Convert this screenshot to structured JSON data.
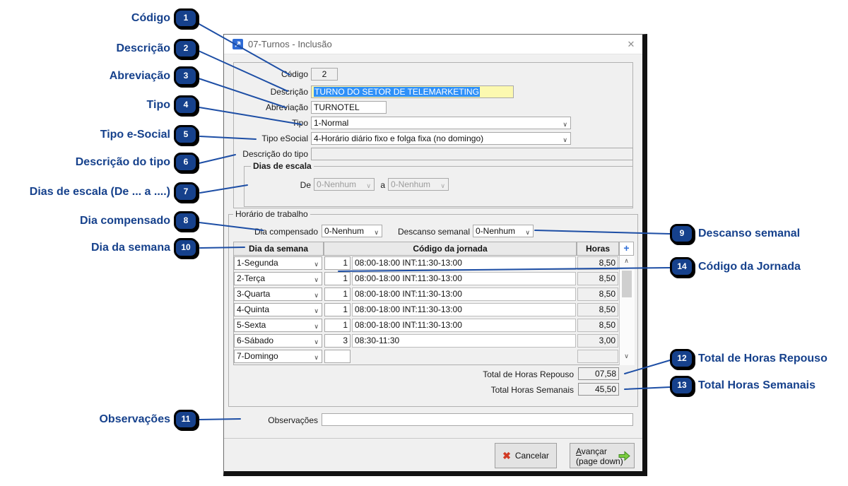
{
  "dialog": {
    "title": "07-Turnos - Inclusão",
    "fields": {
      "codigo": {
        "label": "Código",
        "value": "2"
      },
      "descricao": {
        "label": "Descrição",
        "value": "TURNO DO SETOR DE TELEMARKETING"
      },
      "abreviacao": {
        "label": "Abreviação",
        "value": "TURNOTEL"
      },
      "tipo": {
        "label": "Tipo",
        "value": "1-Normal"
      },
      "tipo_esocial": {
        "label": "Tipo eSocial",
        "value": "4-Horário diário fixo e folga fixa (no domingo)"
      },
      "descricao_tipo": {
        "label": "Descrição do tipo",
        "value": ""
      }
    },
    "dias_escala": {
      "legend": "Dias de escala",
      "de_label": "De",
      "de_value": "0-Nenhum",
      "a_label": "a",
      "a_value": "0-Nenhum"
    },
    "horario": {
      "legend": "Horário de trabalho",
      "dia_compensado": {
        "label": "Dia compensado",
        "value": "0-Nenhum"
      },
      "descanso_semanal": {
        "label": "Descanso semanal",
        "value": "0-Nenhum"
      },
      "table": {
        "headers": [
          "Dia da semana",
          "Código da jornada",
          "Horas"
        ],
        "rows": [
          {
            "dia": "1-Segunda",
            "codigo": "1",
            "jornada": "08:00-18:00 INT:11:30-13:00",
            "horas": "8,50"
          },
          {
            "dia": "2-Terça",
            "codigo": "1",
            "jornada": "08:00-18:00 INT:11:30-13:00",
            "horas": "8,50"
          },
          {
            "dia": "3-Quarta",
            "codigo": "1",
            "jornada": "08:00-18:00 INT:11:30-13:00",
            "horas": "8,50"
          },
          {
            "dia": "4-Quinta",
            "codigo": "1",
            "jornada": "08:00-18:00 INT:11:30-13:00",
            "horas": "8,50"
          },
          {
            "dia": "5-Sexta",
            "codigo": "1",
            "jornada": "08:00-18:00 INT:11:30-13:00",
            "horas": "8,50"
          },
          {
            "dia": "6-Sábado",
            "codigo": "3",
            "jornada": "08:30-11:30",
            "horas": "3,00"
          },
          {
            "dia": "7-Domingo",
            "codigo": "",
            "jornada": "",
            "horas": ""
          }
        ]
      },
      "totals": [
        {
          "label": "Total de Horas Repouso",
          "value": "07,58"
        },
        {
          "label": "Total Horas Semanais",
          "value": "45,50"
        }
      ]
    },
    "observacoes": {
      "label": "Observações",
      "value": ""
    },
    "buttons": {
      "cancel": "Cancelar",
      "next_line1": "Avançar",
      "next_line2": "(page down)"
    }
  },
  "annotations": {
    "left": [
      {
        "num": "1",
        "label": "Código"
      },
      {
        "num": "2",
        "label": "Descrição"
      },
      {
        "num": "3",
        "label": "Abreviação"
      },
      {
        "num": "4",
        "label": "Tipo"
      },
      {
        "num": "5",
        "label": "Tipo e-Social"
      },
      {
        "num": "6",
        "label": "Descrição do tipo"
      },
      {
        "num": "7",
        "label": "Dias de escala (De ... a ....)"
      },
      {
        "num": "8",
        "label": "Dia compensado"
      },
      {
        "num": "10",
        "label": "Dia da semana"
      },
      {
        "num": "11",
        "label": "Observações"
      }
    ],
    "right": [
      {
        "num": "9",
        "label": "Descanso semanal"
      },
      {
        "num": "14",
        "label": "Código da Jornada"
      },
      {
        "num": "12",
        "label": "Total de Horas Repouso"
      },
      {
        "num": "13",
        "label": "Total Horas Semanais"
      }
    ]
  },
  "icons": {
    "close": "✕",
    "chevron": "∨",
    "plus": "+",
    "cancel_x": "✖",
    "scroll_up": "∧",
    "scroll_down": "∨"
  },
  "colors": {
    "annotation_blue": "#16418c",
    "leader_line_blue": "#1d4ea5",
    "selection_blue": "#2e90f8",
    "field_yellow": "#fcf9b0",
    "plus_blue": "#2f6fd8",
    "cancel_red": "#d13a24",
    "next_green": "#7ccc3f",
    "dialog_bg": "#f0f0f0"
  }
}
